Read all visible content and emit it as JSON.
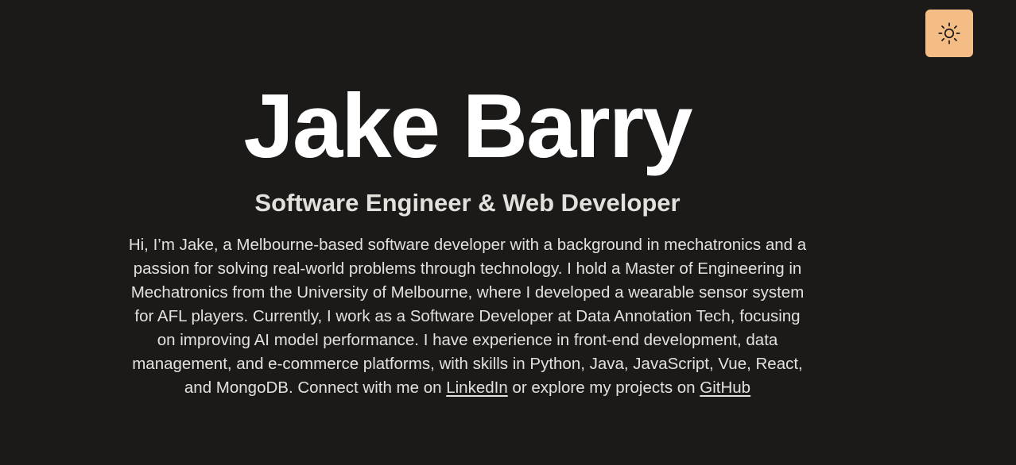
{
  "theme_toggle": {
    "icon": "sun-icon",
    "color": "#f3bd85"
  },
  "hero": {
    "name": "Jake Barry",
    "role": "Software Engineer & Web Developer",
    "bio_text": "Hi, I’m Jake, a Melbourne-based software developer with a background in mechatronics and a passion for solving real-world problems through technology. I hold a Master of Engineering in Mechatronics from the University of Melbourne, where I developed a wearable sensor system for AFL players. Currently, I work as a Software Developer at Data Annotation Tech, focusing on improving AI model performance. I have experience in front-end development, data management, and e-commerce platforms, with skills in Python, Java, JavaScript, Vue, React, and MongoDB. Connect with me on ",
    "linkedin_label": "LinkedIn",
    "between_links_text": " or explore my projects on ",
    "github_label": "GitHub"
  },
  "colors": {
    "background": "#1c1a19",
    "text": "#ffffff",
    "muted_text": "#e4e0dc",
    "accent": "#f3bd85"
  }
}
